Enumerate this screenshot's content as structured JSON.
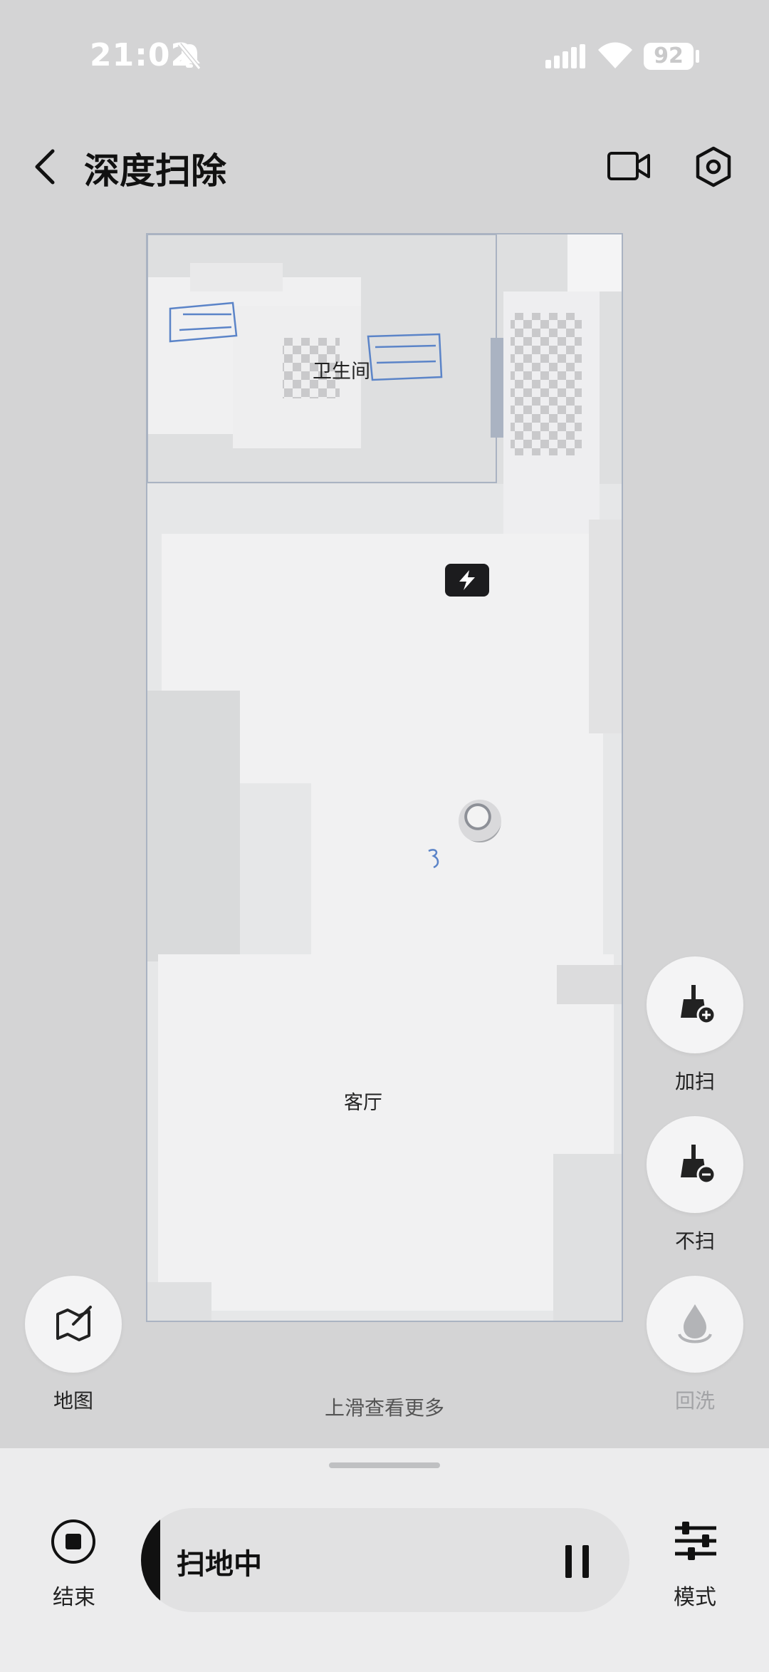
{
  "status_bar": {
    "time": "21:02",
    "battery": "92"
  },
  "header": {
    "title": "深度扫除"
  },
  "map": {
    "rooms": [
      {
        "name": "卫生间"
      },
      {
        "name": "客厅"
      }
    ]
  },
  "side_actions": {
    "add_sweep": "加扫",
    "no_sweep": "不扫",
    "rewash": "回洗",
    "map": "地图"
  },
  "hint": "上滑查看更多",
  "bottom": {
    "end_label": "结束",
    "status": "扫地中",
    "progress": 0.04,
    "mode_label": "模式"
  },
  "colors": {
    "accent_dark": "#111111",
    "map_border": "#aab3c2",
    "marker_blue": "#5b84c8"
  }
}
